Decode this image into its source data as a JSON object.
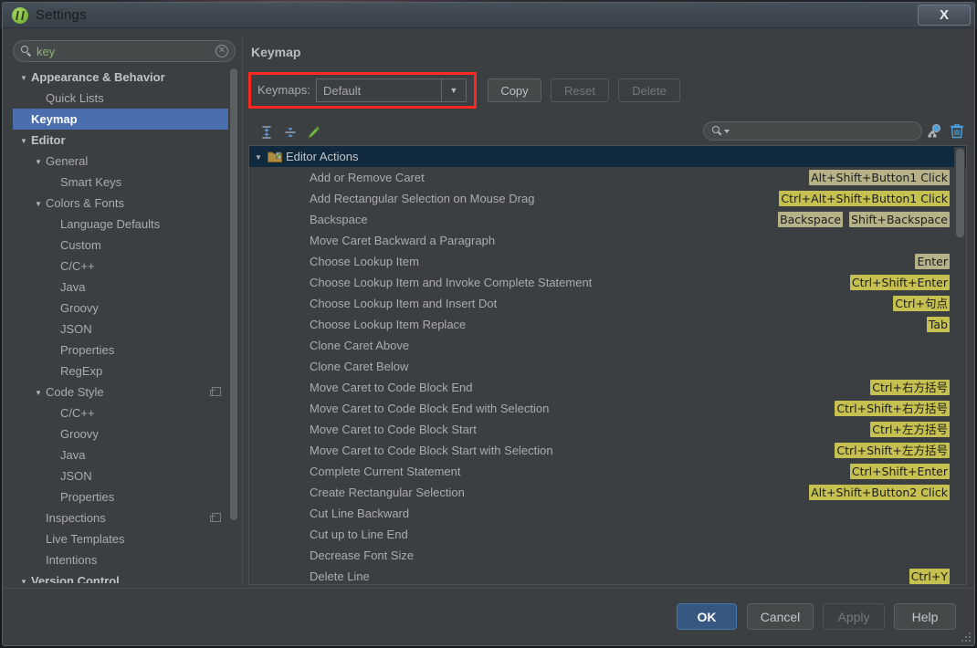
{
  "window": {
    "title": "Settings",
    "app_icon": "android-studio-icon",
    "close_label": "X"
  },
  "sidebar": {
    "search": {
      "value": "key",
      "placeholder": "",
      "icon": "search-icon",
      "clear_icon": "clear-icon"
    },
    "items": [
      {
        "label": "Appearance & Behavior",
        "indent": 0,
        "arrow": "▼",
        "bold": true,
        "selected": false,
        "badge": false
      },
      {
        "label": "Quick Lists",
        "indent": 1,
        "arrow": "",
        "bold": false,
        "selected": false,
        "badge": false
      },
      {
        "label": "Keymap",
        "indent": 0,
        "arrow": "",
        "bold": true,
        "selected": true,
        "badge": false
      },
      {
        "label": "Editor",
        "indent": 0,
        "arrow": "▼",
        "bold": true,
        "selected": false,
        "badge": false
      },
      {
        "label": "General",
        "indent": 1,
        "arrow": "▼",
        "bold": false,
        "selected": false,
        "badge": false
      },
      {
        "label": "Smart Keys",
        "indent": 2,
        "arrow": "",
        "bold": false,
        "selected": false,
        "badge": false
      },
      {
        "label": "Colors & Fonts",
        "indent": 1,
        "arrow": "▼",
        "bold": false,
        "selected": false,
        "badge": false
      },
      {
        "label": "Language Defaults",
        "indent": 2,
        "arrow": "",
        "bold": false,
        "selected": false,
        "badge": false
      },
      {
        "label": "Custom",
        "indent": 2,
        "arrow": "",
        "bold": false,
        "selected": false,
        "badge": false
      },
      {
        "label": "C/C++",
        "indent": 2,
        "arrow": "",
        "bold": false,
        "selected": false,
        "badge": false
      },
      {
        "label": "Java",
        "indent": 2,
        "arrow": "",
        "bold": false,
        "selected": false,
        "badge": false
      },
      {
        "label": "Groovy",
        "indent": 2,
        "arrow": "",
        "bold": false,
        "selected": false,
        "badge": false
      },
      {
        "label": "JSON",
        "indent": 2,
        "arrow": "",
        "bold": false,
        "selected": false,
        "badge": false
      },
      {
        "label": "Properties",
        "indent": 2,
        "arrow": "",
        "bold": false,
        "selected": false,
        "badge": false
      },
      {
        "label": "RegExp",
        "indent": 2,
        "arrow": "",
        "bold": false,
        "selected": false,
        "badge": false
      },
      {
        "label": "Code Style",
        "indent": 1,
        "arrow": "▼",
        "bold": false,
        "selected": false,
        "badge": true
      },
      {
        "label": "C/C++",
        "indent": 2,
        "arrow": "",
        "bold": false,
        "selected": false,
        "badge": false
      },
      {
        "label": "Groovy",
        "indent": 2,
        "arrow": "",
        "bold": false,
        "selected": false,
        "badge": false
      },
      {
        "label": "Java",
        "indent": 2,
        "arrow": "",
        "bold": false,
        "selected": false,
        "badge": false
      },
      {
        "label": "JSON",
        "indent": 2,
        "arrow": "",
        "bold": false,
        "selected": false,
        "badge": false
      },
      {
        "label": "Properties",
        "indent": 2,
        "arrow": "",
        "bold": false,
        "selected": false,
        "badge": false
      },
      {
        "label": "Inspections",
        "indent": 1,
        "arrow": "",
        "bold": false,
        "selected": false,
        "badge": true
      },
      {
        "label": "Live Templates",
        "indent": 1,
        "arrow": "",
        "bold": false,
        "selected": false,
        "badge": false
      },
      {
        "label": "Intentions",
        "indent": 1,
        "arrow": "",
        "bold": false,
        "selected": false,
        "badge": false
      },
      {
        "label": "Version Control",
        "indent": 0,
        "arrow": "▼",
        "bold": true,
        "selected": false,
        "badge": false
      }
    ]
  },
  "main": {
    "heading": "Keymap",
    "keymaps_label": "Keymaps:",
    "keymap_value": "Default",
    "dropdown_arrow": "▼",
    "buttons": [
      {
        "label": "Copy",
        "disabled": false
      },
      {
        "label": "Reset",
        "disabled": true
      },
      {
        "label": "Delete",
        "disabled": true
      }
    ],
    "toolbar": {
      "expand_all_icon": "expand-all-icon",
      "collapse_all_icon": "collapse-all-icon",
      "edit_shortcut_icon": "edit-pencil-icon",
      "search_value": "",
      "search_icon": "search-icon",
      "find_action_icon": "find-action-by-shortcut-icon",
      "delete_icon": "trash-icon"
    },
    "group": {
      "label": "Editor Actions",
      "arrow": "▼",
      "icon": "folder-edit-icon"
    },
    "actions": [
      {
        "name": "Add or Remove Caret",
        "shortcuts": [
          "Alt+Shift+Button1 Click"
        ]
      },
      {
        "name": "Add Rectangular Selection on Mouse Drag",
        "shortcuts": [
          "Ctrl+Alt+Shift+Button1 Click"
        ]
      },
      {
        "name": "Backspace",
        "shortcuts": [
          "Backspace",
          "Shift+Backspace"
        ]
      },
      {
        "name": "Move Caret Backward a Paragraph",
        "shortcuts": []
      },
      {
        "name": "Choose Lookup Item",
        "shortcuts": [
          "Enter"
        ]
      },
      {
        "name": "Choose Lookup Item and Invoke Complete Statement",
        "shortcuts": [
          "Ctrl+Shift+Enter"
        ]
      },
      {
        "name": "Choose Lookup Item and Insert Dot",
        "shortcuts": [
          "Ctrl+句点"
        ]
      },
      {
        "name": "Choose Lookup Item Replace",
        "shortcuts": [
          "Tab"
        ]
      },
      {
        "name": "Clone Caret Above",
        "shortcuts": []
      },
      {
        "name": "Clone Caret Below",
        "shortcuts": []
      },
      {
        "name": "Move Caret to Code Block End",
        "shortcuts": [
          "Ctrl+右方括号"
        ]
      },
      {
        "name": "Move Caret to Code Block End with Selection",
        "shortcuts": [
          "Ctrl+Shift+右方括号"
        ]
      },
      {
        "name": "Move Caret to Code Block Start",
        "shortcuts": [
          "Ctrl+左方括号"
        ]
      },
      {
        "name": "Move Caret to Code Block Start with Selection",
        "shortcuts": [
          "Ctrl+Shift+左方括号"
        ]
      },
      {
        "name": "Complete Current Statement",
        "shortcuts": [
          "Ctrl+Shift+Enter"
        ]
      },
      {
        "name": "Create Rectangular Selection",
        "shortcuts": [
          "Alt+Shift+Button2 Click"
        ]
      },
      {
        "name": "Cut Line Backward",
        "shortcuts": []
      },
      {
        "name": "Cut up to Line End",
        "shortcuts": []
      },
      {
        "name": "Decrease Font Size",
        "shortcuts": []
      },
      {
        "name": "Delete Line",
        "shortcuts": [
          "Ctrl+Y"
        ]
      }
    ]
  },
  "footer": {
    "buttons": [
      {
        "label": "OK",
        "kind": "primary",
        "disabled": false
      },
      {
        "label": "Cancel",
        "kind": "normal",
        "disabled": false
      },
      {
        "label": "Apply",
        "kind": "normal",
        "disabled": true
      },
      {
        "label": "Help",
        "kind": "normal",
        "disabled": false
      }
    ]
  },
  "colors": {
    "window_bg": "#3c3f41",
    "selection_blue": "#4b6eaf",
    "group_row_bg": "#10293d",
    "shortcut_olive": "#b7b188",
    "shortcut_yellow": "#c5c04f",
    "highlight_red": "#fb2a21",
    "primary_button": "#365880",
    "search_text_green": "#8fb573"
  }
}
